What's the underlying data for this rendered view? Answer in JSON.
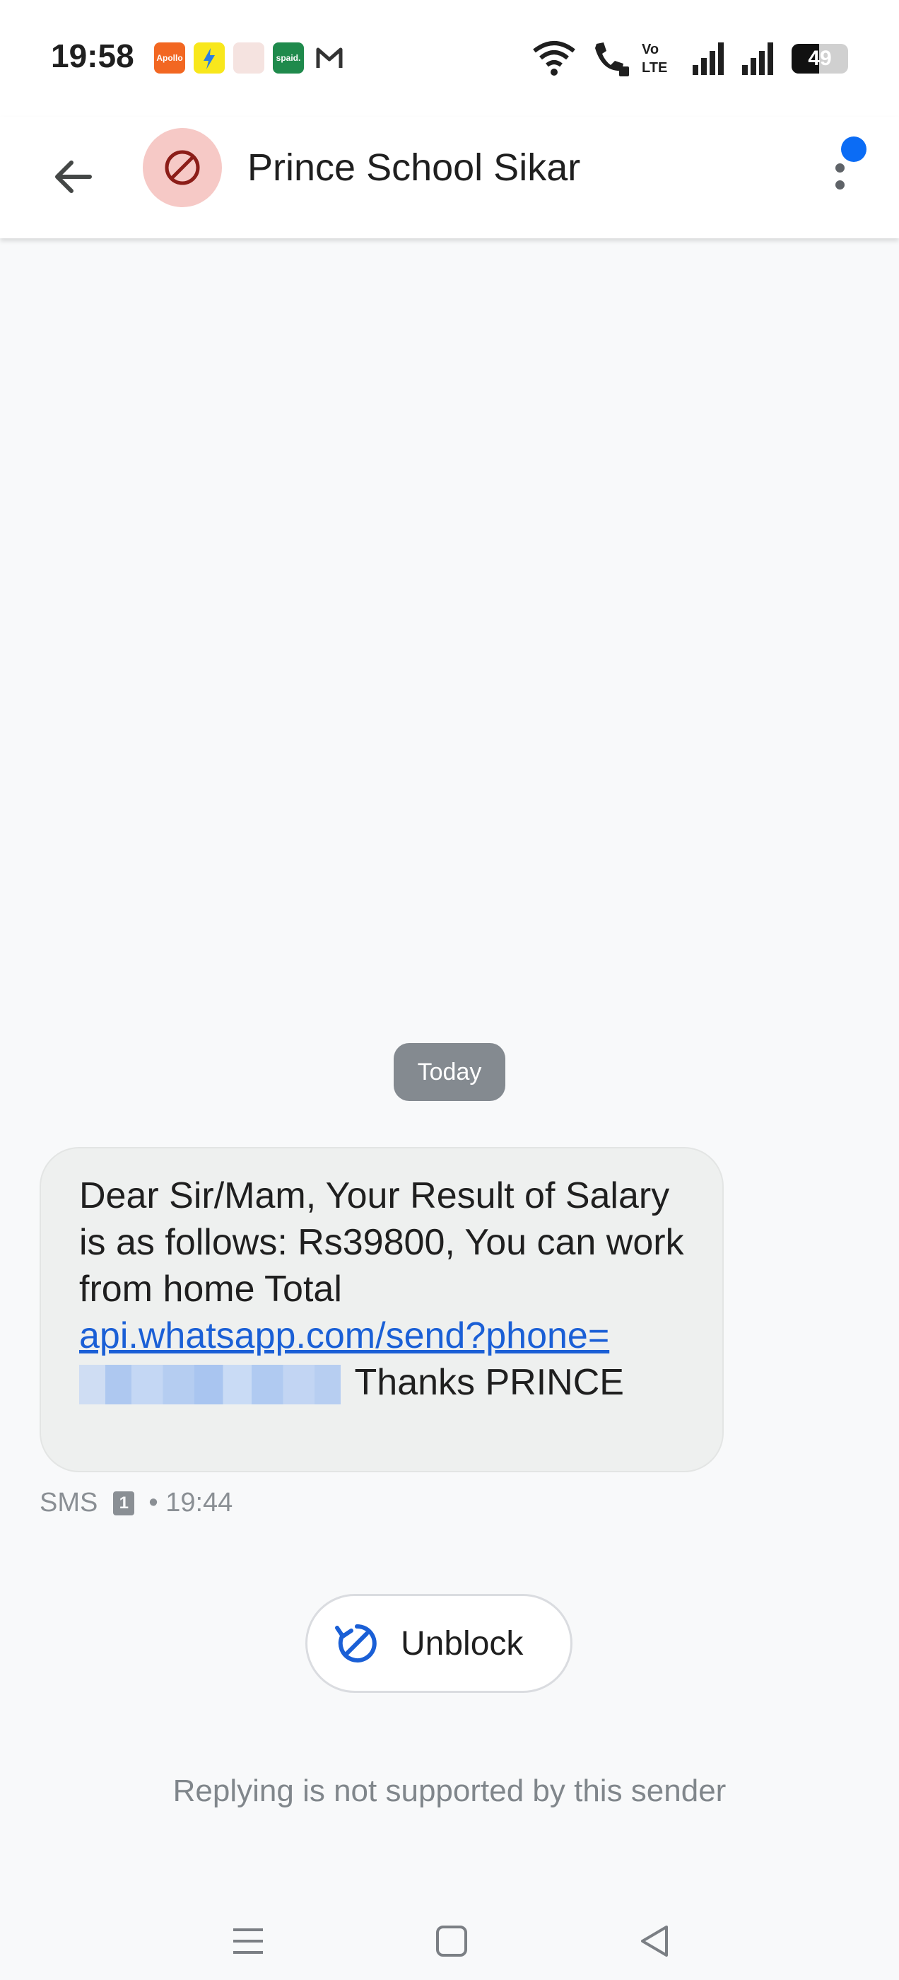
{
  "status_bar": {
    "time": "19:58",
    "notification_icons": [
      "apollo-247-icon",
      "flipkart-icon",
      "app-icon",
      "spaid-icon",
      "gmail-icon"
    ],
    "notification_labels": {
      "apollo": "Apollo 24|7",
      "spaid": "spaid."
    },
    "system_icons": [
      "wifi-icon",
      "wifi-calling-icon",
      "volte-icon",
      "signal-icon",
      "signal-icon"
    ],
    "volte_text": {
      "top": "Vo",
      "bottom": "LTE"
    },
    "battery_percent": "49",
    "battery_level": 0.49
  },
  "app_bar": {
    "contact_name": "Prince School Sikar",
    "avatar_icon": "blocked-icon",
    "back_icon": "back-arrow-icon",
    "more_icon": "more-vert-icon"
  },
  "conversation": {
    "date_chip": "Today",
    "message": {
      "text_before": "Dear Sir/Mam, Your Result of Salary is as follows: Rs39800, You can work from home Total ",
      "link": "api.whatsapp.com/send?phone=",
      "text_after": " Thanks PRINCE"
    },
    "meta": {
      "type": "SMS",
      "sim": "1",
      "time": "• 19:44"
    }
  },
  "actions": {
    "unblock_label": "Unblock",
    "reply_note": "Replying is not supported by this sender"
  },
  "colors": {
    "accent": "#1a5fd6",
    "avatar_bg": "#f6c9c6",
    "blocked_red": "#b3261e",
    "chip_bg": "#848a90",
    "bubble_bg": "#eef0ef"
  }
}
